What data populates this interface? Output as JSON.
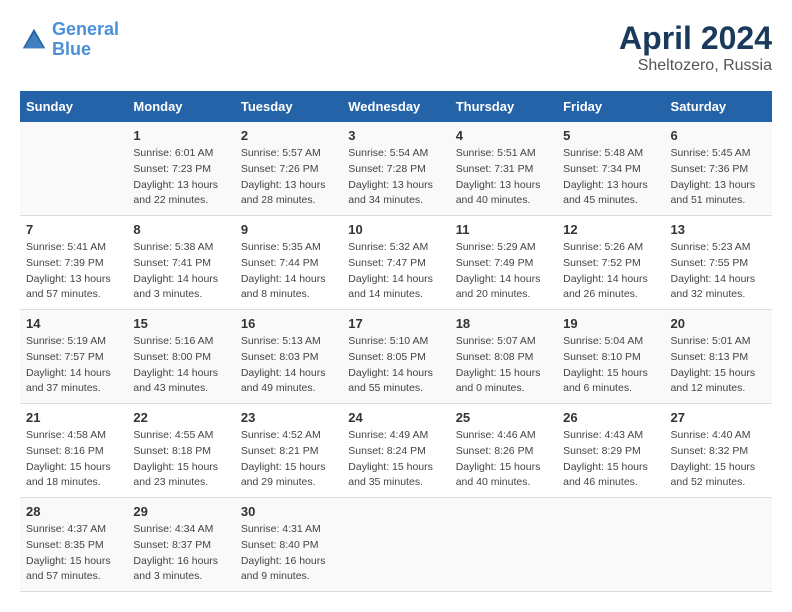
{
  "header": {
    "logo_line1": "General",
    "logo_line2": "Blue",
    "main_title": "April 2024",
    "subtitle": "Sheltozero, Russia"
  },
  "days_of_week": [
    "Sunday",
    "Monday",
    "Tuesday",
    "Wednesday",
    "Thursday",
    "Friday",
    "Saturday"
  ],
  "weeks": [
    [
      {
        "day": "",
        "info": ""
      },
      {
        "day": "1",
        "info": "Sunrise: 6:01 AM\nSunset: 7:23 PM\nDaylight: 13 hours\nand 22 minutes."
      },
      {
        "day": "2",
        "info": "Sunrise: 5:57 AM\nSunset: 7:26 PM\nDaylight: 13 hours\nand 28 minutes."
      },
      {
        "day": "3",
        "info": "Sunrise: 5:54 AM\nSunset: 7:28 PM\nDaylight: 13 hours\nand 34 minutes."
      },
      {
        "day": "4",
        "info": "Sunrise: 5:51 AM\nSunset: 7:31 PM\nDaylight: 13 hours\nand 40 minutes."
      },
      {
        "day": "5",
        "info": "Sunrise: 5:48 AM\nSunset: 7:34 PM\nDaylight: 13 hours\nand 45 minutes."
      },
      {
        "day": "6",
        "info": "Sunrise: 5:45 AM\nSunset: 7:36 PM\nDaylight: 13 hours\nand 51 minutes."
      }
    ],
    [
      {
        "day": "7",
        "info": "Sunrise: 5:41 AM\nSunset: 7:39 PM\nDaylight: 13 hours\nand 57 minutes."
      },
      {
        "day": "8",
        "info": "Sunrise: 5:38 AM\nSunset: 7:41 PM\nDaylight: 14 hours\nand 3 minutes."
      },
      {
        "day": "9",
        "info": "Sunrise: 5:35 AM\nSunset: 7:44 PM\nDaylight: 14 hours\nand 8 minutes."
      },
      {
        "day": "10",
        "info": "Sunrise: 5:32 AM\nSunset: 7:47 PM\nDaylight: 14 hours\nand 14 minutes."
      },
      {
        "day": "11",
        "info": "Sunrise: 5:29 AM\nSunset: 7:49 PM\nDaylight: 14 hours\nand 20 minutes."
      },
      {
        "day": "12",
        "info": "Sunrise: 5:26 AM\nSunset: 7:52 PM\nDaylight: 14 hours\nand 26 minutes."
      },
      {
        "day": "13",
        "info": "Sunrise: 5:23 AM\nSunset: 7:55 PM\nDaylight: 14 hours\nand 32 minutes."
      }
    ],
    [
      {
        "day": "14",
        "info": "Sunrise: 5:19 AM\nSunset: 7:57 PM\nDaylight: 14 hours\nand 37 minutes."
      },
      {
        "day": "15",
        "info": "Sunrise: 5:16 AM\nSunset: 8:00 PM\nDaylight: 14 hours\nand 43 minutes."
      },
      {
        "day": "16",
        "info": "Sunrise: 5:13 AM\nSunset: 8:03 PM\nDaylight: 14 hours\nand 49 minutes."
      },
      {
        "day": "17",
        "info": "Sunrise: 5:10 AM\nSunset: 8:05 PM\nDaylight: 14 hours\nand 55 minutes."
      },
      {
        "day": "18",
        "info": "Sunrise: 5:07 AM\nSunset: 8:08 PM\nDaylight: 15 hours\nand 0 minutes."
      },
      {
        "day": "19",
        "info": "Sunrise: 5:04 AM\nSunset: 8:10 PM\nDaylight: 15 hours\nand 6 minutes."
      },
      {
        "day": "20",
        "info": "Sunrise: 5:01 AM\nSunset: 8:13 PM\nDaylight: 15 hours\nand 12 minutes."
      }
    ],
    [
      {
        "day": "21",
        "info": "Sunrise: 4:58 AM\nSunset: 8:16 PM\nDaylight: 15 hours\nand 18 minutes."
      },
      {
        "day": "22",
        "info": "Sunrise: 4:55 AM\nSunset: 8:18 PM\nDaylight: 15 hours\nand 23 minutes."
      },
      {
        "day": "23",
        "info": "Sunrise: 4:52 AM\nSunset: 8:21 PM\nDaylight: 15 hours\nand 29 minutes."
      },
      {
        "day": "24",
        "info": "Sunrise: 4:49 AM\nSunset: 8:24 PM\nDaylight: 15 hours\nand 35 minutes."
      },
      {
        "day": "25",
        "info": "Sunrise: 4:46 AM\nSunset: 8:26 PM\nDaylight: 15 hours\nand 40 minutes."
      },
      {
        "day": "26",
        "info": "Sunrise: 4:43 AM\nSunset: 8:29 PM\nDaylight: 15 hours\nand 46 minutes."
      },
      {
        "day": "27",
        "info": "Sunrise: 4:40 AM\nSunset: 8:32 PM\nDaylight: 15 hours\nand 52 minutes."
      }
    ],
    [
      {
        "day": "28",
        "info": "Sunrise: 4:37 AM\nSunset: 8:35 PM\nDaylight: 15 hours\nand 57 minutes."
      },
      {
        "day": "29",
        "info": "Sunrise: 4:34 AM\nSunset: 8:37 PM\nDaylight: 16 hours\nand 3 minutes."
      },
      {
        "day": "30",
        "info": "Sunrise: 4:31 AM\nSunset: 8:40 PM\nDaylight: 16 hours\nand 9 minutes."
      },
      {
        "day": "",
        "info": ""
      },
      {
        "day": "",
        "info": ""
      },
      {
        "day": "",
        "info": ""
      },
      {
        "day": "",
        "info": ""
      }
    ]
  ]
}
